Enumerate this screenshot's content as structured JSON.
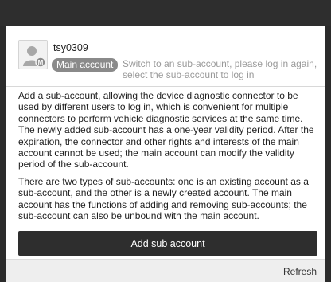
{
  "user": {
    "name": "tsy0309",
    "badge": "Main account",
    "switch_hint": "Switch to an sub-account, please log in again, select the sub-account to log in",
    "avatar_icon": "user-avatar-icon"
  },
  "description": {
    "paragraph1": "Add a sub-account, allowing the device diagnostic connector to be used by different users to log in, which is convenient for multiple connectors to perform vehicle diagnostic services at the same time. The newly added sub-account has a one-year validity period. After the expiration, the connector and other rights and interests of the main account cannot be used; the main account can modify the validity period of the sub-account.",
    "paragraph2": "There are two types of sub-accounts: one is an existing account as a sub-account, and the other is a newly created account. The main account has the functions of adding and removing sub-accounts; the sub-account can also be unbound with the main account."
  },
  "actions": {
    "add_label": "Add sub account",
    "refresh_label": "Refresh"
  },
  "colors": {
    "topbar": "#2e2e2e",
    "button": "#2e2e2e",
    "badge": "#8a8a8a",
    "hint": "#9a9a9a"
  }
}
